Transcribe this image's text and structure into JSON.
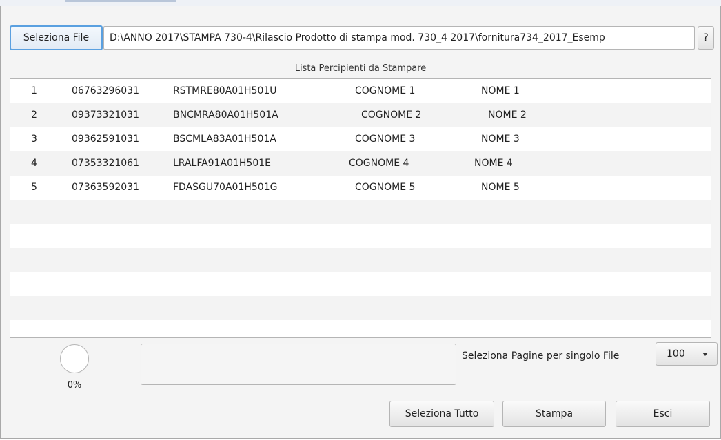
{
  "toolbar": {
    "select_file_label": "Seleziona File",
    "file_path": "D:\\ANNO 2017\\STAMPA  730-4\\Rilascio Prodotto di stampa mod. 730_4 2017\\fornitura734_2017_Esemp",
    "help_label": "?"
  },
  "list": {
    "title": "Lista Percipienti da Stampare",
    "rows": [
      {
        "num": "1",
        "piva": "06763296031",
        "cf": "RSTMRE80A01H501U",
        "cognome": "COGNOME 1",
        "nome": "NOME 1"
      },
      {
        "num": "2",
        "piva": "09373321031",
        "cf": "BNCMRA80A01H501A",
        "cognome": "COGNOME 2",
        "nome": "NOME 2"
      },
      {
        "num": "3",
        "piva": "09362591031",
        "cf": "BSCMLA83A01H501A",
        "cognome": "COGNOME 3",
        "nome": "NOME 3"
      },
      {
        "num": "4",
        "piva": "07353321061",
        "cf": "LRALFA91A01H501E",
        "cognome": "COGNOME 4",
        "nome": "NOME 4"
      },
      {
        "num": "5",
        "piva": "07363592031",
        "cf": "FDASGU70A01H501G",
        "cognome": "COGNOME 5",
        "nome": "NOME 5"
      }
    ]
  },
  "progress": {
    "value": 0,
    "label": "0%"
  },
  "pages": {
    "label": "Seleziona Pagine per singolo File",
    "selected": "100"
  },
  "actions": {
    "select_all_label": "Seleziona Tutto",
    "print_label": "Stampa",
    "exit_label": "Esci"
  },
  "colors": {
    "focus_border": "#5aa0e0",
    "row_alt": "#f3f3f3"
  }
}
